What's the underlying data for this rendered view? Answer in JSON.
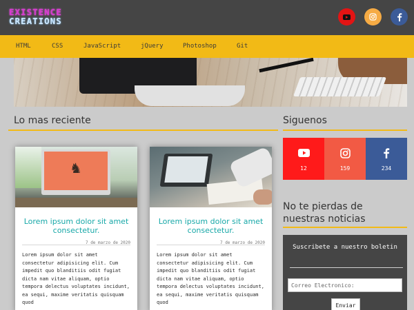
{
  "header": {
    "logo_line1": "EXISTENCE",
    "logo_line2": "CREATIONS",
    "social": [
      "youtube-icon",
      "instagram-icon",
      "facebook-icon"
    ]
  },
  "nav": {
    "items": [
      "HTML",
      "CSS",
      "JavaScript",
      "jQuery",
      "Photoshop",
      "Git"
    ]
  },
  "main": {
    "section_title": "Lo mas reciente",
    "posts": [
      {
        "title": "Lorem ipsum dolor sit amet consectetur.",
        "date": "7 de marzo de 2020",
        "excerpt": "Lorem ipsum dolor sit amet consectetur adipisicing elit. Cum impedit quo blanditiis odit fugiat dicta nam vitae aliquam, optio tempora delectus voluptates incidunt, ea sequi, maxime veritatis quisquam quod"
      },
      {
        "title": "Lorem ipsum dolor sit amet consectetur.",
        "date": "7 de marzo de 2020",
        "excerpt": "Lorem ipsum dolor sit amet consectetur adipisicing elit. Cum impedit quo blanditiis odit fugiat dicta nam vitae aliquam, optio tempora delectus voluptates incidunt, ea sequi, maxime veritatis quisquam quod"
      }
    ]
  },
  "sidebar": {
    "follow_title": "Siguenos",
    "social_counts": [
      {
        "icon": "youtube-icon",
        "count": "12",
        "color": "#ff1a1a"
      },
      {
        "icon": "instagram-icon",
        "count": "159",
        "color": "#f25a44"
      },
      {
        "icon": "facebook-icon",
        "count": "234",
        "color": "#3b5b98"
      }
    ],
    "newsletter_title": "No te pierdas de nuestras noticias",
    "newsletter_heading": "Suscribete a nuestro boletin",
    "email_placeholder": "Correo Electronico:",
    "submit_label": "Enviar"
  },
  "colors": {
    "accent": "#f2ba16",
    "header_bg": "#454545",
    "page_bg": "#cbcbcb",
    "post_title": "#18a8a8"
  }
}
